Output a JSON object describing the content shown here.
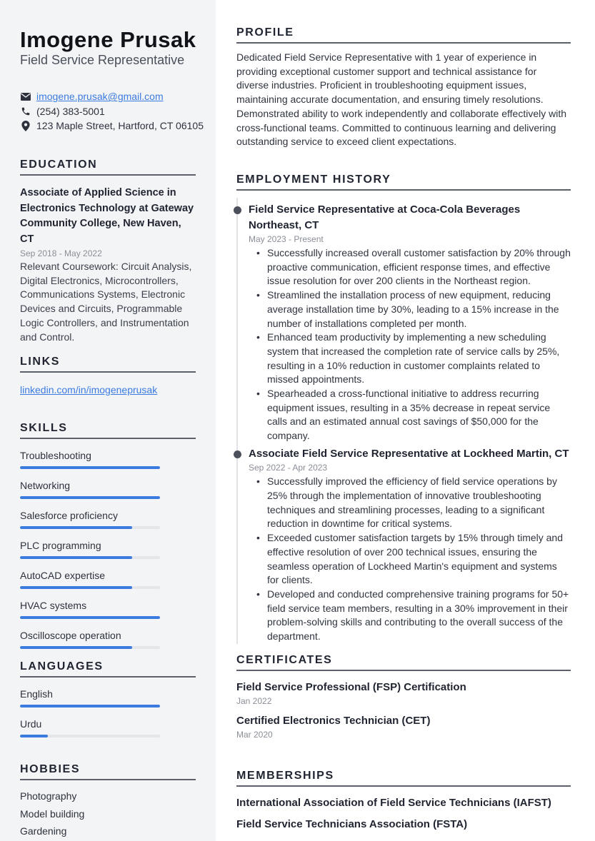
{
  "header": {
    "name": "Imogene Prusak",
    "title": "Field Service Representative"
  },
  "contact": {
    "email": "imogene.prusak@gmail.com",
    "phone": "(254) 383-5001",
    "address": "123 Maple Street, Hartford, CT 06105",
    "icons": [
      "envelope-icon",
      "phone-icon",
      "map-pin-icon"
    ]
  },
  "education": {
    "title": "EDUCATION",
    "degree": "Associate of Applied Science in Electronics Technology at Gateway Community College, New Haven, CT",
    "dates": "Sep 2018 - May 2022",
    "description": "Relevant Coursework: Circuit Analysis, Digital Electronics, Microcontrollers, Communications Systems, Electronic Devices and Circuits, Programmable Logic Controllers, and Instrumentation and Control."
  },
  "links": {
    "title": "LINKS",
    "items": [
      "linkedin.com/in/imogeneprusak"
    ]
  },
  "skills": {
    "title": "SKILLS",
    "items": [
      {
        "name": "Troubleshooting",
        "level": 1.0
      },
      {
        "name": "Networking",
        "level": 1.0
      },
      {
        "name": "Salesforce proficiency",
        "level": 0.8
      },
      {
        "name": "PLC programming",
        "level": 0.8
      },
      {
        "name": "AutoCAD expertise",
        "level": 0.8
      },
      {
        "name": "HVAC systems",
        "level": 1.0
      },
      {
        "name": "Oscilloscope operation",
        "level": 0.8
      }
    ]
  },
  "languages": {
    "title": "LANGUAGES",
    "items": [
      {
        "name": "English",
        "level": 1.0
      },
      {
        "name": "Urdu",
        "level": 0.2
      }
    ]
  },
  "hobbies": {
    "title": "HOBBIES",
    "items": [
      "Photography",
      "Model building",
      "Gardening"
    ]
  },
  "profile": {
    "title": "PROFILE",
    "text": "Dedicated Field Service Representative with 1 year of experience in providing exceptional customer support and technical assistance for diverse industries. Proficient in troubleshooting equipment issues, maintaining accurate documentation, and ensuring timely resolutions. Demonstrated ability to work independently and collaborate effectively with cross-functional teams. Committed to continuous learning and delivering outstanding service to exceed client expectations."
  },
  "employment": {
    "title": "EMPLOYMENT HISTORY",
    "jobs": [
      {
        "title": "Field Service Representative at Coca-Cola Beverages Northeast, CT",
        "dates": "May 2023 - Present",
        "bullets": [
          "Successfully increased overall customer satisfaction by 20% through proactive communication, efficient response times, and effective issue resolution for over 200 clients in the Northeast region.",
          "Streamlined the installation process of new equipment, reducing average installation time by 30%, leading to a 15% increase in the number of installations completed per month.",
          "Enhanced team productivity by implementing a new scheduling system that increased the completion rate of service calls by 25%, resulting in a 10% reduction in customer complaints related to missed appointments.",
          "Spearheaded a cross-functional initiative to address recurring equipment issues, resulting in a 35% decrease in repeat service calls and an estimated annual cost savings of $50,000 for the company."
        ]
      },
      {
        "title": "Associate Field Service Representative at Lockheed Martin, CT",
        "dates": "Sep 2022 - Apr 2023",
        "bullets": [
          "Successfully improved the efficiency of field service operations by 25% through the implementation of innovative troubleshooting techniques and streamlining processes, leading to a significant reduction in downtime for critical systems.",
          "Exceeded customer satisfaction targets by 15% through timely and effective resolution of over 200 technical issues, ensuring the seamless operation of Lockheed Martin's equipment and systems for clients.",
          "Developed and conducted comprehensive training programs for 50+ field service team members, resulting in a 30% improvement in their problem-solving skills and contributing to the overall success of the department."
        ]
      }
    ]
  },
  "certificates": {
    "title": "CERTIFICATES",
    "items": [
      {
        "name": "Field Service Professional (FSP) Certification",
        "date": "Jan 2022"
      },
      {
        "name": "Certified Electronics Technician (CET)",
        "date": "Mar 2020"
      }
    ]
  },
  "memberships": {
    "title": "MEMBERSHIPS",
    "items": [
      "International Association of Field Service Technicians (IAFST)",
      "Field Service Technicians Association (FSTA)"
    ]
  },
  "colors": {
    "accent": "#3b7be0",
    "sidebar_bg": "#f3f4f6",
    "bar_track": "#e4e6ea",
    "text": "#1f2430"
  }
}
